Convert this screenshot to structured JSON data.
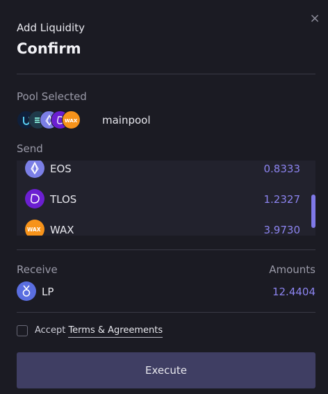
{
  "header": {
    "subtitle": "Add Liquidity",
    "title": "Confirm",
    "close_symbol": "×"
  },
  "pool": {
    "label": "Pool Selected",
    "name": "mainpool",
    "icons": [
      "unknown-token-icon",
      "stacked-token-icon",
      "eos-icon",
      "tlos-icon",
      "wax-icon"
    ]
  },
  "send": {
    "label": "Send",
    "tokens": [
      {
        "symbol": "EOS",
        "amount": "0.8333",
        "icon": "eos-icon",
        "color": "#7b7fe6"
      },
      {
        "symbol": "TLOS",
        "amount": "1.2327",
        "icon": "tlos-icon",
        "color": "#6b1fd1"
      },
      {
        "symbol": "WAX",
        "amount": "3.9730",
        "icon": "wax-icon",
        "color": "#f7931a"
      }
    ]
  },
  "receive": {
    "label": "Receive",
    "amounts_label": "Amounts",
    "token": {
      "symbol": "LP",
      "amount": "12.4404",
      "icon": "lp-badge-icon"
    }
  },
  "agreement": {
    "prefix": "Accept",
    "link_text": "Terms & Agreements",
    "checked": false
  },
  "execute_label": "Execute",
  "colors": {
    "background": "#1b1b23",
    "accent": "#8c84f0",
    "button": "#3f3e63"
  }
}
